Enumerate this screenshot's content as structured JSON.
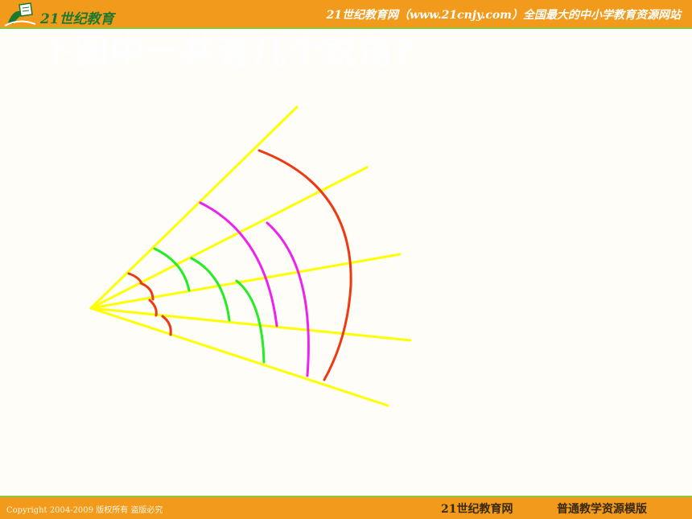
{
  "header": {
    "logo_text": "21世纪教育",
    "tagline": "21世纪教育网（www.21cnjy.com）全国最大的中小学教育资源网站"
  },
  "slide": {
    "title": "下图中一共有几个锐角?"
  },
  "footer": {
    "copyright": "Copyright 2004-2009 版权所有 盗版必究",
    "brand": "21世纪教育网",
    "template_label": "普通教学资源模版"
  },
  "colors": {
    "header_bg": "#f29a1c",
    "accent_green": "#8dc63f",
    "ray": "#ffff00",
    "arc_red": "#ee3a12",
    "arc_green": "#22ee22",
    "arc_magenta": "#ee22ee"
  }
}
